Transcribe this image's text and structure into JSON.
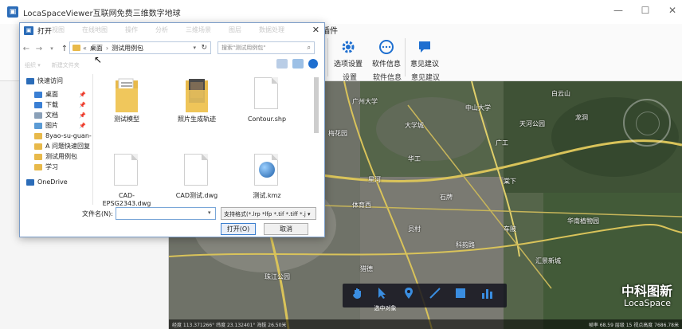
{
  "app": {
    "title": "LocaSpaceViewer互联网免费三维数字地球",
    "menu_plugin": "插件",
    "window_controls": [
      "—",
      "☐",
      "✕"
    ]
  },
  "ribbon": {
    "groups": [
      {
        "label": "选项设置",
        "icon": "gear-icon"
      },
      {
        "label": "软件信息",
        "icon": "info-dots-icon"
      },
      {
        "label": "意见建议",
        "icon": "feedback-icon"
      }
    ],
    "subs": [
      "设置",
      "软件信息",
      "意见建议"
    ]
  },
  "map": {
    "labels": [
      "广州大学",
      "大学城",
      "中山大学",
      "广工",
      "华工",
      "星河",
      "白云山",
      "天河公园",
      "梅花园",
      "石牌",
      "龙洞",
      "棠下",
      "体育西",
      "员村",
      "科韵路",
      "车陂",
      "华南植物园",
      "汇景新城",
      "猎德",
      "珠江公园"
    ],
    "brand_cn": "中科图新",
    "brand_en": "LocaSpace",
    "status_left": "经度 113.371266° 纬度 23.132401° 海拔 26.50米",
    "status_right": "帧率 68.59 层级 15 视点高度 7686.78米",
    "toolbar_tip": "选中对象",
    "tools": [
      "hand-icon",
      "pointer-icon",
      "pin-icon",
      "line-icon",
      "rectangle-icon",
      "chart-icon"
    ]
  },
  "dialog": {
    "title": "打开",
    "ghost_menu": [
      "视图",
      "在线地图",
      "操作",
      "分析",
      "三维场景",
      "图层",
      "数据处理"
    ],
    "address": {
      "folder": "«",
      "segments": [
        "桌面",
        "测试用例包"
      ]
    },
    "search_placeholder": "搜索\"测试用例包\"",
    "cmdbar": [
      "组织 ▾",
      "新建文件夹"
    ],
    "nav": [
      {
        "label": "快速访问",
        "color": "#2b6cb8",
        "sub": false,
        "pin": ""
      },
      {
        "label": "桌面",
        "color": "#3a7fd4",
        "sub": true,
        "pin": "📌"
      },
      {
        "label": "下载",
        "color": "#3a7fd4",
        "sub": true,
        "pin": "📌"
      },
      {
        "label": "文档",
        "color": "#8aa0b8",
        "sub": true,
        "pin": "📌"
      },
      {
        "label": "图片",
        "color": "#5b9bd5",
        "sub": true,
        "pin": "📌"
      },
      {
        "label": "8yao-su-guan-",
        "color": "#e8b94a",
        "sub": true,
        "pin": ""
      },
      {
        "label": "A 问题快速回复",
        "color": "#e8b94a",
        "sub": true,
        "pin": ""
      },
      {
        "label": "测试用例包",
        "color": "#e8b94a",
        "sub": true,
        "pin": ""
      },
      {
        "label": "学习",
        "color": "#e8b94a",
        "sub": true,
        "pin": ""
      },
      {
        "label": "OneDrive",
        "color": "#2b6cb8",
        "sub": false,
        "pin": ""
      }
    ],
    "files": [
      {
        "name": "测试模型",
        "type": "folder-docs"
      },
      {
        "name": "照片生成轨迹",
        "type": "folder-photo"
      },
      {
        "name": "Contour.shp",
        "type": "doc"
      },
      {
        "name": "CAD-EPSG2343.dwg",
        "type": "doc"
      },
      {
        "name": "CAD测试.dwg",
        "type": "doc"
      },
      {
        "name": "测试.kmz",
        "type": "kmz"
      }
    ],
    "filename_label": "文件名(N):",
    "filename_value": "",
    "filter": "支持格式(*.lrp *lfp *.tif *.tiff *.j ▾",
    "open_label": "打开(O)",
    "cancel_label": "取消"
  }
}
